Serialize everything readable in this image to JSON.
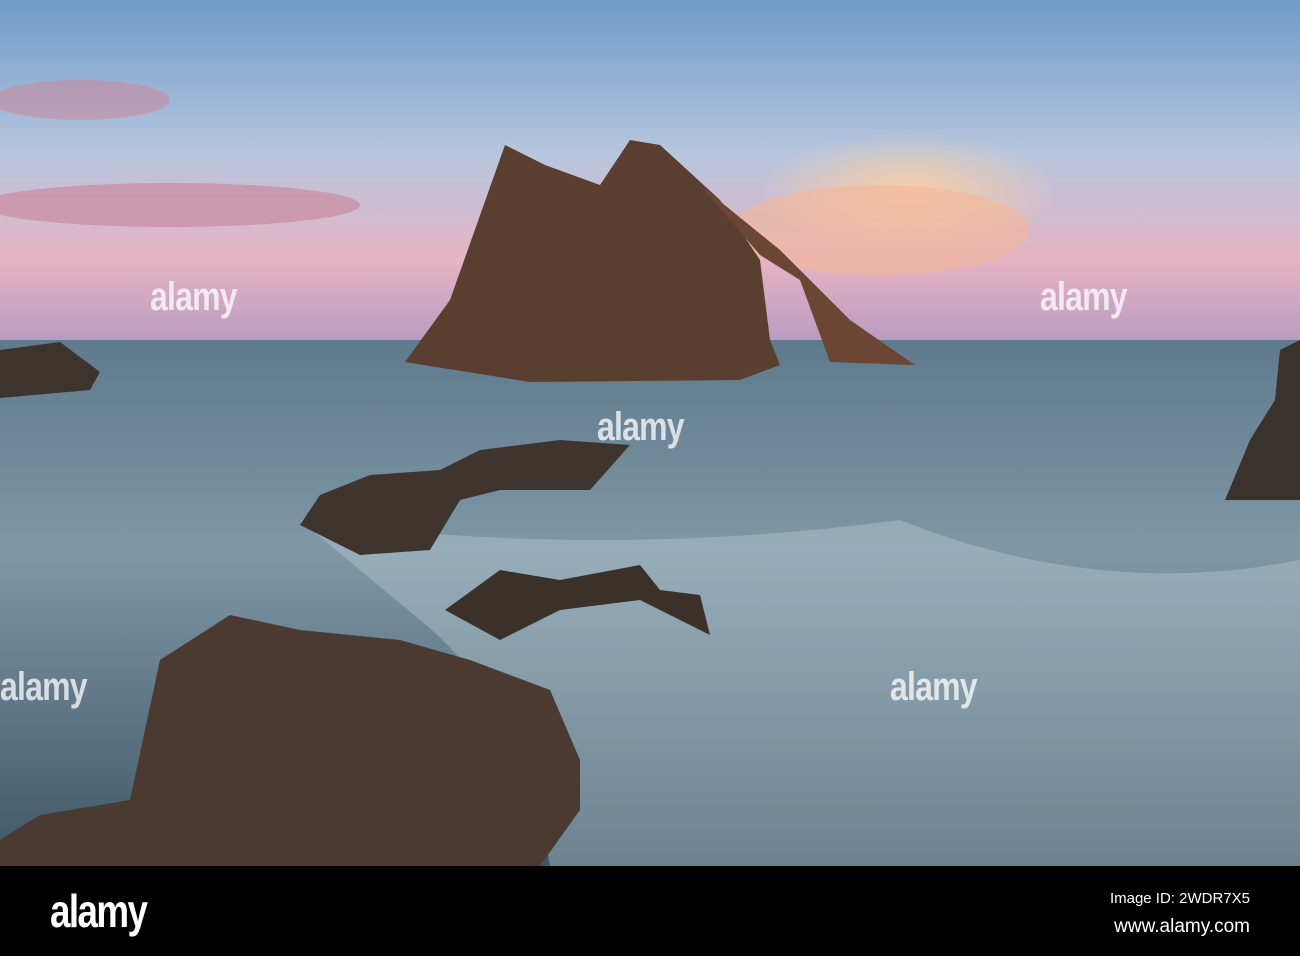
{
  "watermark": {
    "text": "alamy"
  },
  "footer": {
    "logo": "alamy",
    "image_id": "Image ID: 2WDR7X5",
    "url": "www.alamy.com"
  }
}
